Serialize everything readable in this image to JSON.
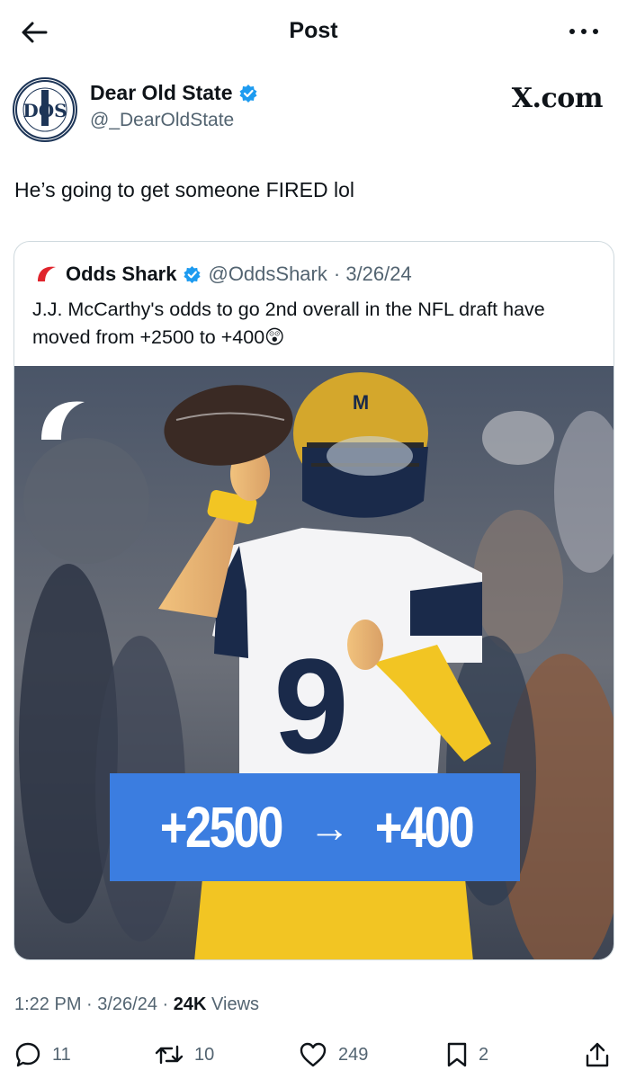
{
  "header": {
    "title": "Post"
  },
  "post": {
    "display_name": "Dear Old State",
    "handle": "@_DearOldState",
    "avatar_text": "DOS",
    "watermark": "X.com",
    "text": "He’s going to get someone FIRED lol",
    "timestamp": "1:22 PM · 3/26/24 · ",
    "views_count": "24K",
    "views_label": " Views"
  },
  "quote": {
    "display_name": "Odds Shark",
    "handle": "@OddsShark",
    "date": "· 3/26/24",
    "text": "J.J. McCarthy's odds to go 2nd overall in the NFL draft have moved from +2500 to +400😲",
    "image": {
      "odds_from": "+2500",
      "arrow": "→",
      "odds_to": "+400",
      "jersey_number": "9",
      "helmet_text": "M",
      "banner_color": "#3b7de0"
    }
  },
  "actions": {
    "replies": "11",
    "reposts": "10",
    "likes": "249",
    "bookmarks": "2"
  },
  "colors": {
    "verified": "#1d9bf0",
    "secondary_text": "#536471",
    "border": "#cfd9de"
  }
}
